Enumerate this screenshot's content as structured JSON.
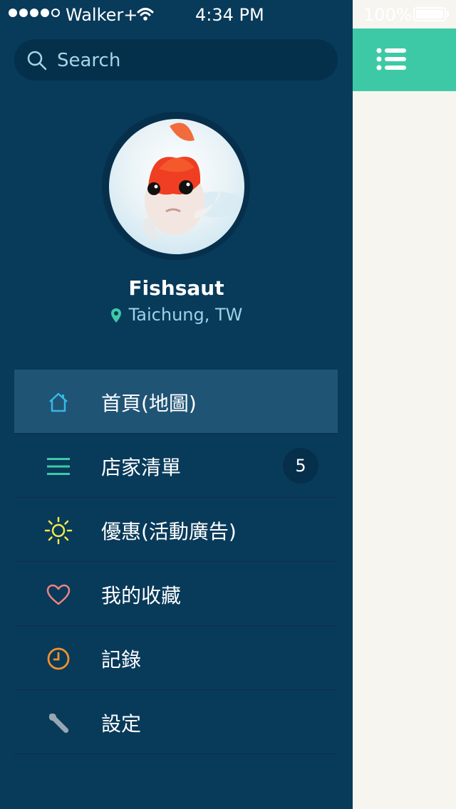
{
  "status_bar": {
    "carrier": "Walker+",
    "time": "4:34 PM",
    "battery": "100%"
  },
  "search": {
    "placeholder": "Search"
  },
  "profile": {
    "name": "Fishsaut",
    "location": "Taichung, TW"
  },
  "menu": [
    {
      "label": "首頁(地圖)",
      "icon": "home-icon",
      "active": true
    },
    {
      "label": "店家清單",
      "icon": "list-icon",
      "badge": "5"
    },
    {
      "label": "優惠(活動廣告)",
      "icon": "sun-icon"
    },
    {
      "label": "我的收藏",
      "icon": "heart-icon"
    },
    {
      "label": "記錄",
      "icon": "clock-icon"
    },
    {
      "label": "設定",
      "icon": "wrench-icon"
    }
  ],
  "colors": {
    "drawer": "#083a5a",
    "accent": "#3ec9a6",
    "active_row": "#1f5475"
  }
}
